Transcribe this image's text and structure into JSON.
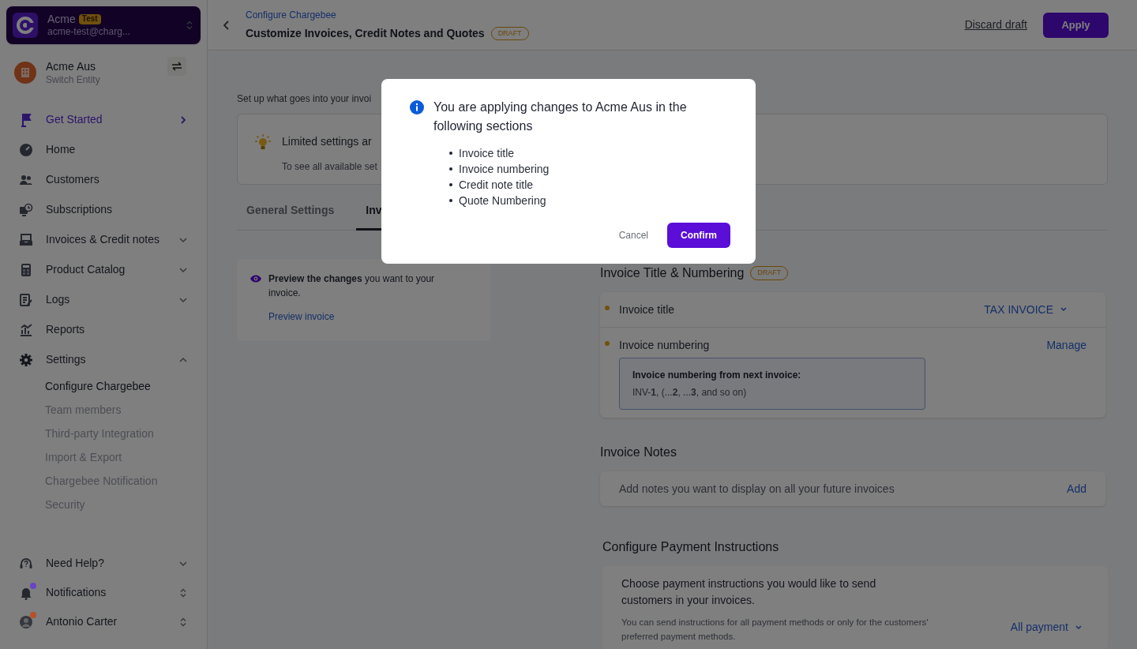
{
  "account": {
    "name": "Acme",
    "badge": "Test",
    "email": "acme-test@charg..."
  },
  "entity": {
    "name": "Acme Aus",
    "subtitle": "Switch Entity"
  },
  "nav": [
    {
      "label": "Get Started",
      "selected": true
    },
    {
      "label": "Home",
      "selected": false
    },
    {
      "label": "Customers",
      "selected": false
    },
    {
      "label": "Subscriptions",
      "selected": false
    },
    {
      "label": "Invoices & Credit notes",
      "selected": false,
      "expanded": false
    },
    {
      "label": "Product Catalog",
      "selected": false,
      "expanded": false
    },
    {
      "label": "Logs",
      "selected": false,
      "expanded": false
    },
    {
      "label": "Reports",
      "selected": false
    },
    {
      "label": "Settings",
      "selected": false,
      "expanded": true,
      "children": [
        {
          "label": "Configure Chargebee",
          "selected": true
        },
        {
          "label": "Team members",
          "selected": false
        },
        {
          "label": "Third-party Integration",
          "selected": false
        },
        {
          "label": "Import & Export",
          "selected": false
        },
        {
          "label": "Chargebee Notification",
          "selected": false
        },
        {
          "label": "Security",
          "selected": false
        }
      ]
    }
  ],
  "footer_nav": [
    {
      "label": "Need Help?"
    },
    {
      "label": "Notifications",
      "color": "#6a44c4"
    },
    {
      "label": "Antonio Carter",
      "color": "#b5502a"
    }
  ],
  "header": {
    "breadcrumb": "Configure Chargebee",
    "title": "Customize Invoices, Credit Notes and Quotes",
    "badge": "DRAFT",
    "discard": "Discard draft",
    "apply": "Apply"
  },
  "intro": "Set up what goes into your invoi",
  "banner": {
    "title": "Limited settings ar",
    "text": "To see all available set"
  },
  "tabs": [
    {
      "label": "General Settings",
      "selected": false
    },
    {
      "label": "Inv",
      "selected": true
    }
  ],
  "preview_card": {
    "text": "**Preview the changes** you want to your invoice.",
    "link": "Preview invoice"
  },
  "sections": [
    {
      "title": "Invoice Title & Numbering",
      "badge": "DRAFT",
      "rows": [
        {
          "kind": "select",
          "label": "Invoice title",
          "changed": true,
          "action": "TAX INVOICE"
        },
        {
          "kind": "action",
          "label": "Invoice numbering",
          "changed": true,
          "action": "Manage",
          "info": {
            "title": "Invoice numbering from next invoice:",
            "text": "INV-**1**, (...**2**, ...**3**, and so on)"
          }
        }
      ]
    },
    {
      "title": "Invoice Notes",
      "rows": [
        {
          "kind": "note",
          "label": "Add notes you want to display on all your future invoices",
          "changed": false,
          "action": "Add"
        }
      ]
    }
  ],
  "payment": {
    "title": "Configure Payment Instructions",
    "text": "Choose payment instructions you would like to send customers in your invoices.",
    "hint": "You can send instructions for all payment methods or only for the customers' preferred payment methods.",
    "select": "All payment"
  },
  "modal": {
    "title": "You are applying changes to Acme Aus in the following sections",
    "items": [
      "Invoice title",
      "Invoice numbering",
      "Credit note title",
      "Quote Numbering"
    ],
    "cancel": "Cancel",
    "confirm": "Confirm"
  }
}
